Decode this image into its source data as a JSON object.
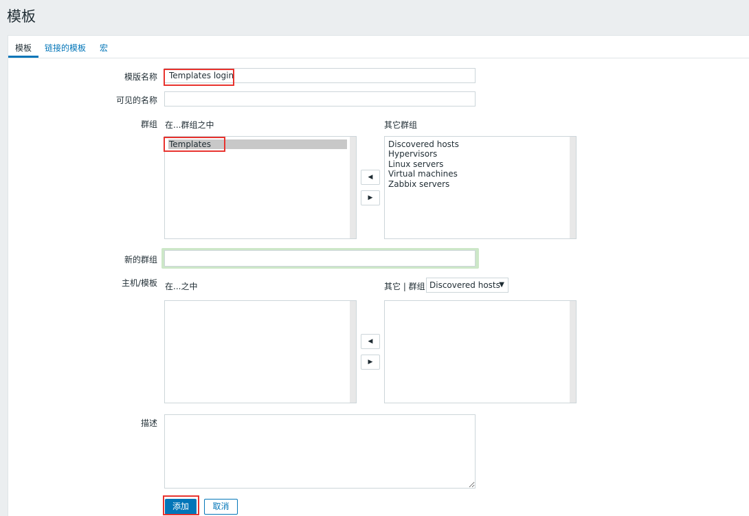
{
  "page": {
    "title": "模板"
  },
  "tabs": [
    {
      "label": "模板",
      "active": true
    },
    {
      "label": "链接的模板",
      "active": false
    },
    {
      "label": "宏",
      "active": false
    }
  ],
  "form": {
    "template_name": {
      "label": "模版名称",
      "value": "Templates login"
    },
    "visible_name": {
      "label": "可见的名称",
      "value": ""
    },
    "groups": {
      "label": "群组",
      "in_label": "在...群组之中",
      "other_label": "其它群组",
      "in_items": [
        "Templates"
      ],
      "selected_in": "Templates",
      "other_items": [
        "Discovered hosts",
        "Hypervisors",
        "Linux servers",
        "Virtual machines",
        "Zabbix servers"
      ]
    },
    "new_group": {
      "label": "新的群组",
      "value": ""
    },
    "hosts_templates": {
      "label": "主机/模板",
      "in_label": "在...之中",
      "other_label": "其它 | 群组",
      "group_select": "Discovered hosts",
      "in_items": [],
      "other_items": []
    },
    "description": {
      "label": "描述",
      "value": ""
    }
  },
  "buttons": {
    "add": "添加",
    "cancel": "取消",
    "move_left": "◀",
    "move_right": "▶"
  },
  "icons": {
    "caret": "chevron-down-icon"
  },
  "colors": {
    "accent": "#0275b8",
    "highlight": "#e8322d",
    "focus": "#cde7c8"
  }
}
